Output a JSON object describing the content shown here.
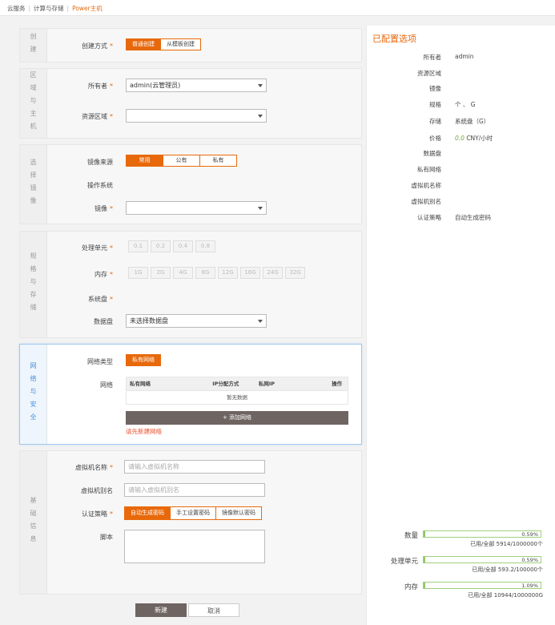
{
  "breadcrumb": {
    "items": [
      "云服务",
      "计算与存储",
      "Power主机"
    ]
  },
  "sections": {
    "create": {
      "label": "创建",
      "method_label": "创建方式",
      "method_options": [
        "普通创建",
        "从模板创建"
      ],
      "method_selected": "普通创建"
    },
    "region": {
      "label": "区域与主机",
      "owner_label": "所有者",
      "owner_value": "admin(云管理员)",
      "zone_label": "资源区域",
      "zone_value": ""
    },
    "image": {
      "label": "选择镜像",
      "source_label": "镜像来源",
      "source_options": [
        "常用",
        "公有",
        "私有"
      ],
      "source_selected": "常用",
      "os_label": "操作系统",
      "image_label": "镜像",
      "image_value": ""
    },
    "spec": {
      "label": "规格与存储",
      "cpu_label": "处理单元",
      "cpu_options": [
        "0.1",
        "0.2",
        "0.4",
        "0.8"
      ],
      "mem_label": "内存",
      "mem_options": [
        "1G",
        "2G",
        "4G",
        "8G",
        "12G",
        "16G",
        "24G",
        "32G"
      ],
      "sysdisk_label": "系统盘",
      "datadisk_label": "数据盘",
      "datadisk_value": "未选择数据盘"
    },
    "network": {
      "label": "网络与安全",
      "type_label": "网络类型",
      "type_value": "私有网络",
      "net_label": "网络",
      "table_headers": [
        "私有网络",
        "IP分配方式",
        "私网IP",
        "操作"
      ],
      "empty_text": "暂无数据",
      "add_button": "+ 添加网络",
      "warning": "请先新建网络"
    },
    "basic": {
      "label": "基础信息",
      "name_label": "虚拟机名称",
      "name_placeholder": "请输入虚拟机名称",
      "alias_label": "虚拟机别名",
      "alias_placeholder": "请输入虚拟机别名",
      "auth_label": "认证策略",
      "auth_options": [
        "自动生成密码",
        "手工设置密码",
        "镜像默认密码"
      ],
      "auth_selected": "自动生成密码",
      "script_label": "脚本"
    }
  },
  "footer": {
    "create_label": "新建",
    "cancel_label": "取消"
  },
  "summary": {
    "title": "已配置选项",
    "items": [
      {
        "key": "所有者",
        "value": "admin"
      },
      {
        "key": "资源区域",
        "value": ""
      },
      {
        "key": "镜像",
        "value": ""
      },
      {
        "key": "规格",
        "value": "个 、 G"
      },
      {
        "key": "存储",
        "value": "系统盘（G）"
      },
      {
        "key": "价格",
        "value_num": "0.0",
        "value_unit": " CNY/小时"
      },
      {
        "key": "数据盘",
        "value": ""
      },
      {
        "key": "私有网络",
        "value": ""
      },
      {
        "key": "虚拟机名称",
        "value": ""
      },
      {
        "key": "虚拟机别名",
        "value": ""
      },
      {
        "key": "认证策略",
        "value": "自动生成密码"
      }
    ],
    "quotas": [
      {
        "name": "数量",
        "percent_label": "0.59%",
        "fraction": 0.0059,
        "detail": "已用/全部 5914/1000000个"
      },
      {
        "name": "处理单元",
        "percent_label": "0.59%",
        "fraction": 0.0059,
        "detail": "已用/全部 593.2/100000个"
      },
      {
        "name": "内存",
        "percent_label": "1.09%",
        "fraction": 0.0109,
        "detail": "已用/全部 10944/1000000G"
      }
    ]
  },
  "colors": {
    "accent": "#e8690c",
    "dark_button": "#6e6461",
    "progress": "#8cc765",
    "active_border": "#9fc7ea"
  }
}
